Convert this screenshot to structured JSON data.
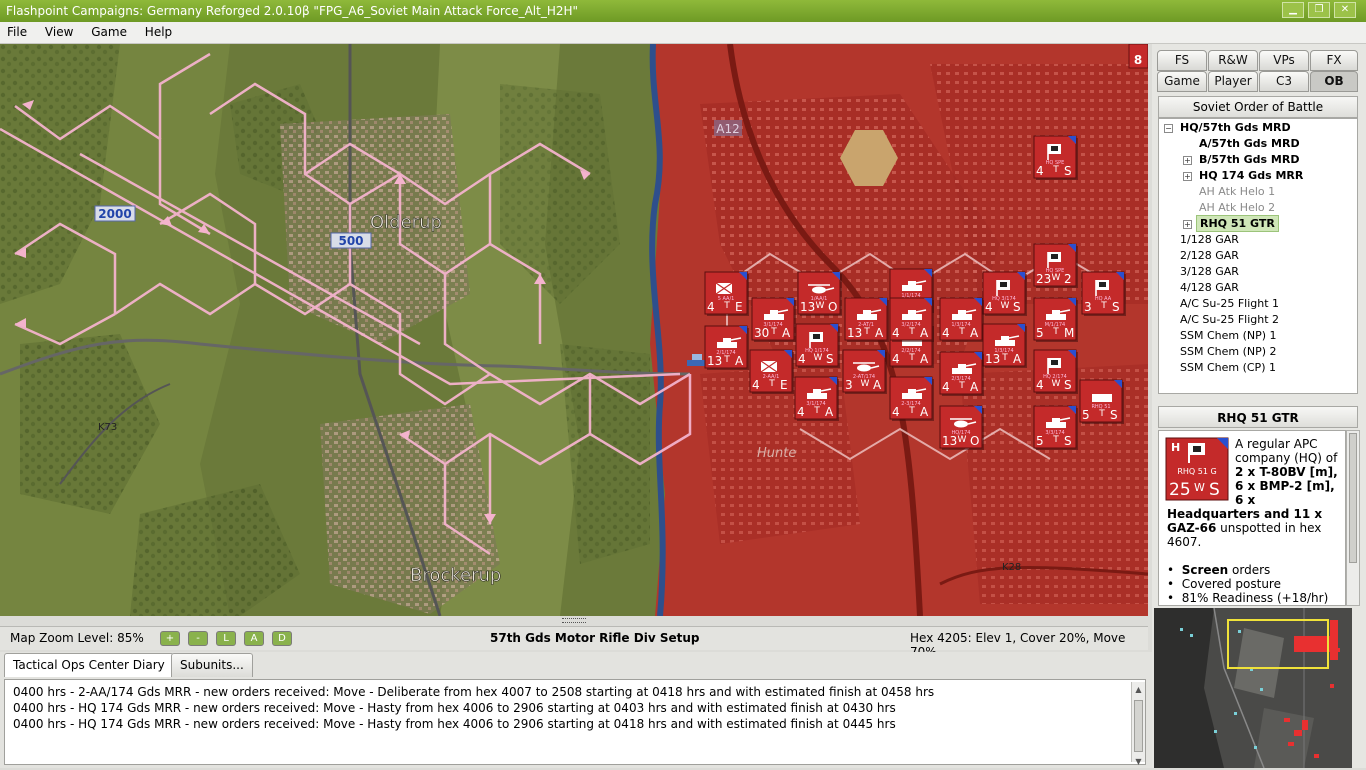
{
  "window": {
    "title": "Flashpoint Campaigns: Germany Reforged  2.0.10β  \"FPG_A6_Soviet Main Attack Force_Alt_H2H\""
  },
  "menu": [
    "File",
    "View",
    "Game",
    "Help"
  ],
  "map": {
    "towns": [
      "Olderup",
      "Brockerup",
      "Hunte"
    ],
    "roads": [
      "A12",
      "K73",
      "K28"
    ],
    "elevation_labels": [
      "2000",
      "500"
    ],
    "edge_counters": [
      "8"
    ],
    "counters": [
      {
        "code": "5 AA/1",
        "value": "4",
        "move": "T",
        "status": "E",
        "icon": "supply-icon"
      },
      {
        "code": "1/AA/1",
        "value": "13",
        "move": "W",
        "status": "O",
        "icon": "helicopter-icon"
      },
      {
        "code": "1/1/174",
        "value": "4",
        "move": "T",
        "status": "A",
        "icon": "tank-icon"
      },
      {
        "code": "3/1/174",
        "value": "30",
        "move": "T",
        "status": "A",
        "icon": "tank-icon"
      },
      {
        "code": "2/1/174",
        "value": "13",
        "move": "T",
        "status": "A",
        "icon": "tank-icon"
      },
      {
        "code": "HQ 1/174",
        "value": "4",
        "move": "W",
        "status": "S",
        "icon": "hq-flag-icon"
      },
      {
        "code": "2/2/174",
        "value": "4",
        "move": "T",
        "status": "A",
        "icon": "tank-icon"
      },
      {
        "code": "HQ 3/174",
        "value": "4",
        "move": "W",
        "status": "S",
        "icon": "hq-flag-icon"
      },
      {
        "code": "1/3/174",
        "value": "4",
        "move": "T",
        "status": "A",
        "icon": "tank-icon"
      },
      {
        "code": "HQ SPE",
        "value": "23",
        "move": "W",
        "status": "2",
        "icon": "hq-car-icon"
      },
      {
        "code": "HQ AA",
        "value": "3",
        "move": "T",
        "status": "S",
        "icon": "hq-flag-icon"
      },
      {
        "code": "2-AT/1",
        "value": "13",
        "move": "T",
        "status": "A",
        "icon": "tank-icon"
      },
      {
        "code": "2-AA/1",
        "value": "4",
        "move": "T",
        "status": "E",
        "icon": "supply-icon"
      },
      {
        "code": "2-AT/174",
        "value": "3",
        "move": "W",
        "status": "A",
        "icon": "helicopter-icon"
      },
      {
        "code": "3/2/174",
        "value": "4",
        "move": "T",
        "status": "A",
        "icon": "tank-icon"
      },
      {
        "code": "1/3/174",
        "value": "13",
        "move": "T",
        "status": "A",
        "icon": "tank-icon"
      },
      {
        "code": "2/3/174",
        "value": "4",
        "move": "T",
        "status": "A",
        "icon": "tank-icon"
      },
      {
        "code": "HQ 2/174",
        "value": "4",
        "move": "W",
        "status": "S",
        "icon": "hq-flag-icon"
      },
      {
        "code": "3/1/174",
        "value": "4",
        "move": "T",
        "status": "A",
        "icon": "tank-icon"
      },
      {
        "code": "2-3/174",
        "value": "4",
        "move": "T",
        "status": "A",
        "icon": "tank-icon"
      },
      {
        "code": "M/1/174",
        "value": "5",
        "move": "T",
        "status": "M",
        "icon": "tank-icon"
      },
      {
        "code": "HQ/174",
        "value": "13",
        "move": "W",
        "status": "O",
        "icon": "helicopter-icon"
      },
      {
        "code": "3/3/174",
        "value": "5",
        "move": "T",
        "status": "S",
        "icon": "tank-icon"
      },
      {
        "code": "RHQ 51",
        "value": "5",
        "move": "T",
        "status": "S",
        "icon": "apc-icon"
      },
      {
        "code": "HQ SPE",
        "value": "4",
        "move": "T",
        "status": "S",
        "icon": "hq-flag-icon"
      }
    ]
  },
  "status": {
    "zoom_label": "Map Zoom Level: 85%",
    "zoom_buttons": [
      "+",
      "-",
      "L",
      "A",
      "D"
    ],
    "phase": "57th Gds Motor Rifle Div Setup",
    "hex_info": "Hex 4205: Elev 1, Cover 20%, Move 70%"
  },
  "bottom": {
    "tabs": [
      "Tactical Ops Center Diary",
      "Subunits..."
    ],
    "log": [
      "0400 hrs - 2-AA/174 Gds MRR - new orders received: Move - Deliberate from hex 4007 to 2508 starting at 0418 hrs and with estimated finish at 0458 hrs",
      "0400 hrs - HQ 174 Gds MRR - new orders received: Move - Hasty from hex 4006 to 2906 starting at 0403 hrs and with estimated finish at 0430 hrs",
      "0400 hrs - HQ 174 Gds MRR - new orders received: Move - Hasty from hex 4006 to 2906 starting at 0418 hrs and with estimated finish at 0445 hrs"
    ]
  },
  "panel": {
    "tabs_row1": [
      "FS",
      "R&W",
      "VPs",
      "FX"
    ],
    "tabs_row2": [
      "Game",
      "Player",
      "C3",
      "OB"
    ],
    "ob_title": "Soviet Order of Battle",
    "tree": [
      {
        "label": "HQ/57th Gds MRD",
        "bold": true
      },
      {
        "label": "A/57th Gds MRD",
        "bold": true
      },
      {
        "label": "B/57th Gds MRD",
        "bold": true
      },
      {
        "label": "HQ 174 Gds MRR",
        "bold": true
      },
      {
        "label": "AH Atk Helo 1",
        "bold": false
      },
      {
        "label": "AH Atk Helo 2",
        "bold": false
      },
      {
        "label": "RHQ 51 GTR",
        "bold": true
      },
      {
        "label": "1/128 GAR",
        "bold": false
      },
      {
        "label": "2/128 GAR",
        "bold": false
      },
      {
        "label": "3/128 GAR",
        "bold": false
      },
      {
        "label": "4/128 GAR",
        "bold": false
      },
      {
        "label": "A/C Su-25 Flight 1",
        "bold": false
      },
      {
        "label": "A/C Su-25 Flight 2",
        "bold": false
      },
      {
        "label": "SSM Chem (NP) 1",
        "bold": false
      },
      {
        "label": "SSM Chem (NP) 2",
        "bold": false
      },
      {
        "label": "SSM Chem (CP) 1",
        "bold": false
      }
    ],
    "unit": {
      "title": "RHQ 51 GTR",
      "counter_code": "RHQ 51 G",
      "counter_value": "25",
      "counter_move": "W",
      "counter_status": "S",
      "desc_1": "A regular APC company (HQ) of",
      "desc_2": "2 x T-80BV [m],",
      "desc_3": "6 x BMP-2 [m],",
      "desc_4": "6 x",
      "desc_5": "Headquarters and 11 x",
      "desc_6a": "GAZ-66",
      "desc_6b": " unspotted in hex",
      "desc_7": "4607.",
      "bullet_1a": "Screen",
      "bullet_1b": " orders",
      "bullet_2": "Covered posture",
      "bullet_3": "81% Readiness (+18/hr)"
    }
  },
  "colors": {
    "title_green": "#7aa62e",
    "enemy_red": "#b52e25",
    "counter_red": "#c42a2a",
    "path_pink": "#f2a9c6",
    "terrain_green": "#6f7f3c"
  }
}
